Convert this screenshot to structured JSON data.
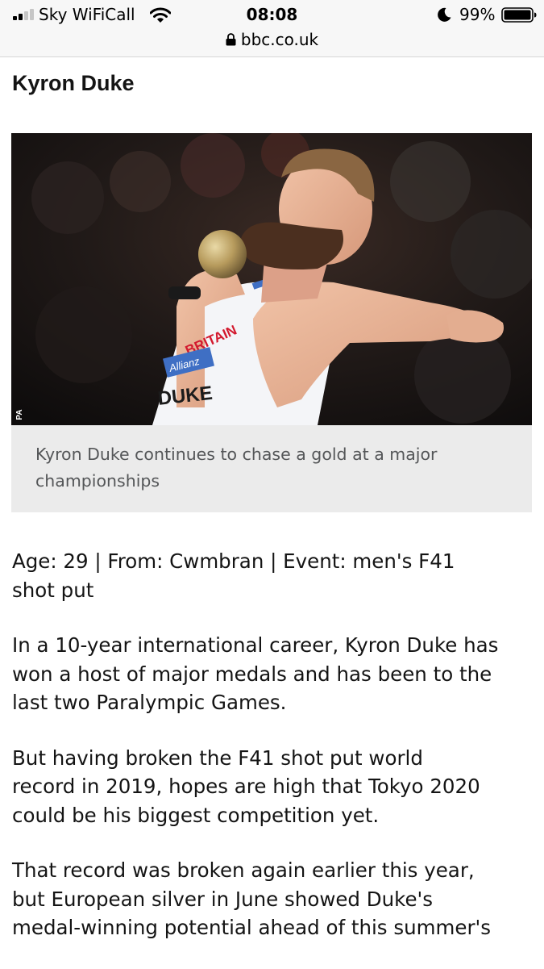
{
  "status_bar": {
    "carrier": "Sky WiFiCall",
    "time": "08:08",
    "battery_percent": "99%",
    "signal_bars_filled": 2,
    "signal_bars_total": 4
  },
  "address_bar": {
    "url": "bbc.co.uk"
  },
  "article": {
    "title": "Kyron Duke",
    "image": {
      "credit": "PA",
      "caption_lines": [
        "Kyron Duke continues to chase a gold at a major",
        "championships"
      ]
    },
    "paragraphs": [
      {
        "lines": [
          "Age: 29 | From: Cwmbran | Event: men's F41",
          "shot put"
        ]
      },
      {
        "lines": [
          "In a 10-year international career, Kyron Duke has",
          "won a host of major medals and has been to the",
          "last two Paralympic Games."
        ]
      },
      {
        "lines": [
          "But having broken the F41 shot put world",
          "record in 2019, hopes are high that Tokyo 2020",
          "could be his biggest competition yet."
        ]
      },
      {
        "lines": [
          "That record was broken again earlier this year,",
          "but European silver in June showed Duke's",
          "medal-winning potential ahead of this summer's"
        ]
      }
    ],
    "vest_text": [
      "BRITAIN",
      "Allianz",
      "DUKE"
    ]
  },
  "colors": {
    "text": "#141414",
    "caption_text": "#545658",
    "caption_bg": "#ebebeb",
    "chrome_bg": "#f7f7f7",
    "vest": "#f4f5f8",
    "vest_trim": "#3f6fc4",
    "britain_red": "#d3192e"
  }
}
